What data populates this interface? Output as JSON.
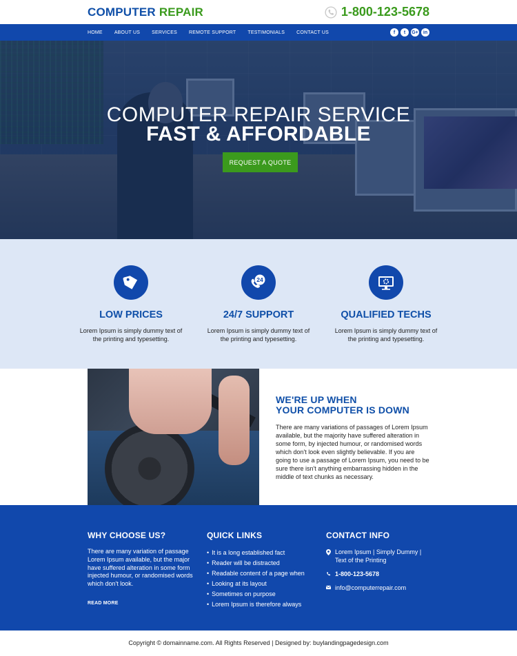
{
  "header": {
    "logo_part1": "COMPUTER",
    "logo_part2": "REPAIR",
    "phone": "1-800-123-5678"
  },
  "nav": {
    "items": [
      "HOME",
      "ABOUT US",
      "SERVICES",
      "REMOTE SUPPORT",
      "TESTIMONIALS",
      "CONTACT US"
    ],
    "social": [
      "f",
      "t",
      "G+",
      "in"
    ]
  },
  "hero": {
    "title_line1": "COMPUTER REPAIR SERVICE",
    "title_line2": "FAST & AFFORDABLE",
    "button": "REQUEST A QUOTE"
  },
  "features": [
    {
      "icon": "price-tag-icon",
      "title": "LOW PRICES",
      "text": "Lorem Ipsum is simply dummy text of the printing and typesetting."
    },
    {
      "icon": "phone-24-icon",
      "title": "24/7 SUPPORT",
      "text": "Lorem Ipsum is simply dummy text of the printing and typesetting."
    },
    {
      "icon": "monitor-gear-icon",
      "title": "QUALIFIED TECHS",
      "text": "Lorem Ipsum is simply dummy text of the printing and typesetting."
    }
  ],
  "about": {
    "heading_line1": "WE'RE UP WHEN",
    "heading_line2": "YOUR COMPUTER IS DOWN",
    "text": "There are many variations of passages of Lorem Ipsum available, but the majority have suffered alteration in some form, by injected humour, or randomised words which don't look even slightly believable.  If you are going to use a passage of Lorem Ipsum, you need to be sure there isn't anything embarrassing hidden in the middle of text chunks as necessary."
  },
  "footer": {
    "why": {
      "title": "WHY CHOOSE US?",
      "text": "There are many variation of passage Lorem Ipsum available, but the major have suffered alteration in some form injected humour, or randomised words which don't look.",
      "read_more": "READ MORE"
    },
    "links": {
      "title": "QUICK LINKS",
      "items": [
        "It is a long established fact",
        "Reader will be distracted",
        "Readable content of a page when",
        "Looking at its layout",
        "Sometimes on purpose",
        "Lorem Ipsum is therefore always"
      ]
    },
    "contact": {
      "title": "CONTACT INFO",
      "address": "Lorem Ipsum |  Simply Dummy | Text of the Printing",
      "phone": "1-800-123-5678",
      "email": "info@computerrepair.com"
    }
  },
  "copyright": "Copyright © domainname.com. All Rights Reserved | Designed by: buylandingpagedesign.com",
  "colors": {
    "primary_blue": "#1148ac",
    "green": "#3b9a1d",
    "light_bg": "#dde7f6"
  }
}
